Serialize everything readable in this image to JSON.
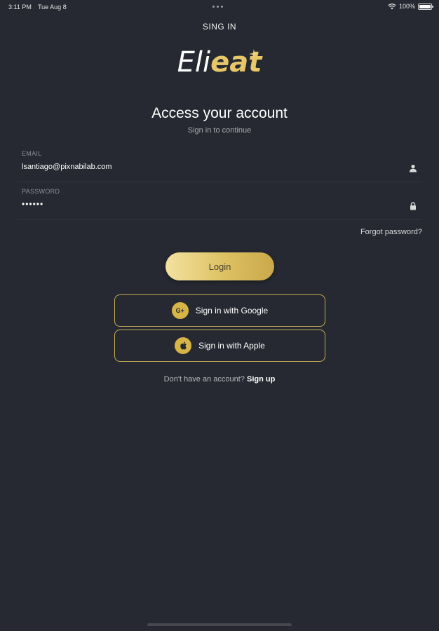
{
  "status_bar": {
    "time": "3:11 PM",
    "date": "Tue Aug 8",
    "battery": "100%"
  },
  "nav": {
    "title": "SING IN"
  },
  "logo": {
    "part1": "Eli",
    "part2": "eat"
  },
  "heading": "Access your account",
  "subheading": "Sign in to continue",
  "email": {
    "label": "EMAIL",
    "value": "lsantiago@pixnabilab.com",
    "icon": "person-icon"
  },
  "password": {
    "label": "PASSWORD",
    "value": "••••••",
    "icon": "lock-icon"
  },
  "forgot_password": "Forgot password?",
  "login_button": "Login",
  "google_button": {
    "label": "Sign in with Google",
    "icon_text": "G+"
  },
  "apple_button": {
    "label": "Sign in with Apple",
    "icon": "apple-icon"
  },
  "signup": {
    "prompt": "Don't have an account?",
    "link": "Sign up"
  },
  "colors": {
    "background": "#262931",
    "accent_gold": "#d6b445",
    "text_primary": "#ffffff",
    "text_secondary": "#a8aab0"
  }
}
